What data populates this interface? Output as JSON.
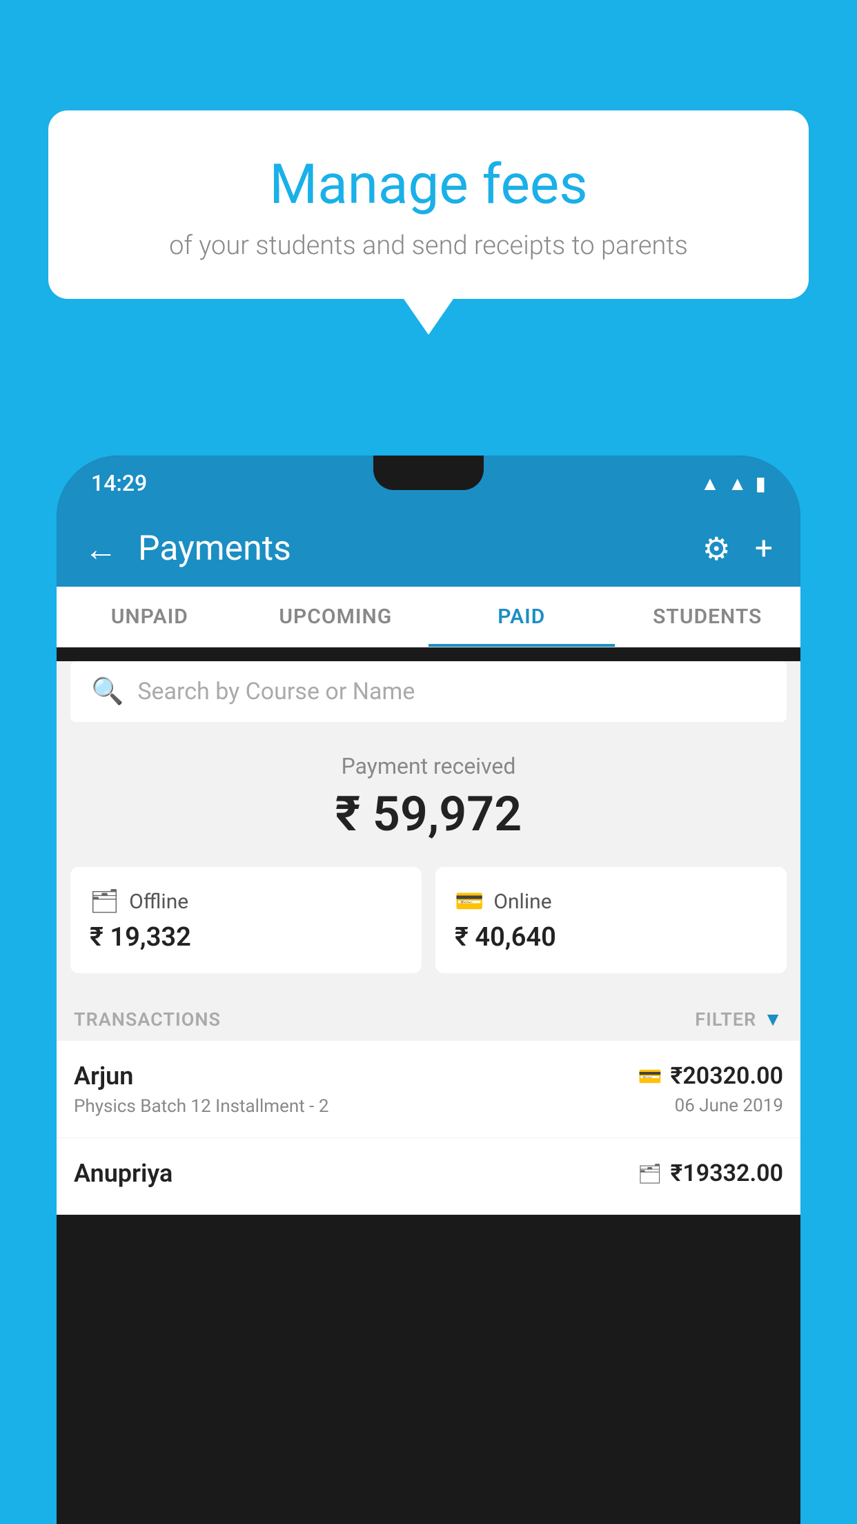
{
  "background_color": "#1ab0e8",
  "speech_bubble": {
    "title": "Manage fees",
    "subtitle": "of your students and send receipts to parents"
  },
  "phone": {
    "status_bar": {
      "time": "14:29"
    },
    "app_header": {
      "title": "Payments",
      "back_label": "←",
      "gear_label": "⚙",
      "plus_label": "+"
    },
    "tabs": [
      {
        "label": "UNPAID",
        "active": false
      },
      {
        "label": "UPCOMING",
        "active": false
      },
      {
        "label": "PAID",
        "active": true
      },
      {
        "label": "STUDENTS",
        "active": false
      }
    ],
    "search": {
      "placeholder": "Search by Course or Name"
    },
    "payment_summary": {
      "label": "Payment received",
      "amount": "₹ 59,972"
    },
    "payment_cards": [
      {
        "icon": "💳",
        "label": "Offline",
        "amount": "₹ 19,332"
      },
      {
        "icon": "💳",
        "label": "Online",
        "amount": "₹ 40,640"
      }
    ],
    "transactions_section": {
      "label": "TRANSACTIONS",
      "filter_label": "FILTER"
    },
    "transactions": [
      {
        "name": "Arjun",
        "course": "Physics Batch 12 Installment - 2",
        "amount": "₹20320.00",
        "date": "06 June 2019",
        "payment_type": "online"
      },
      {
        "name": "Anupriya",
        "course": "",
        "amount": "₹19332.00",
        "date": "",
        "payment_type": "offline"
      }
    ]
  }
}
